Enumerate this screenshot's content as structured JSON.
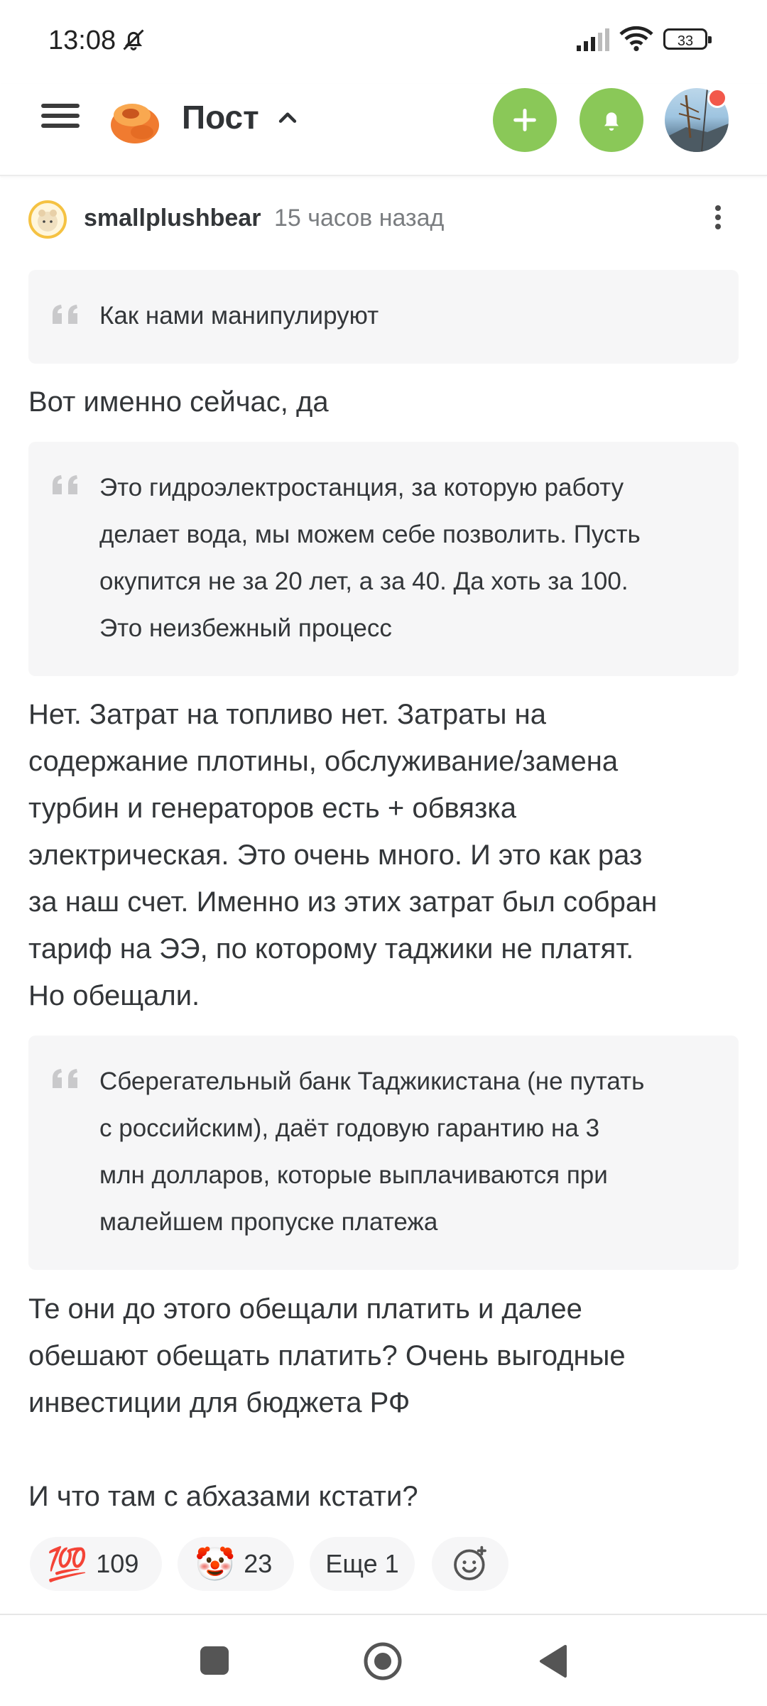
{
  "status_bar": {
    "time": "13:08",
    "battery": "33"
  },
  "header": {
    "title": "Пост"
  },
  "comment": {
    "author": "smallplushbear",
    "time": "15 часов назад",
    "quote1": "Как нами манипулируют",
    "text1": "Вот именно сейчас, да",
    "quote2_lines": [
      "Это гидроэлектростанция, за которую работу",
      "делает вода, мы можем себе позволить. Пусть",
      "окупится не за 20 лет, а за 40. Да хоть за 100.",
      "Это неизбежный процесс"
    ],
    "text2_lines": [
      "Нет. Затрат на топливо нет. Затраты на",
      "содержание плотины, обслуживание/замена",
      "турбин и генераторов есть + обвязка",
      "электрическая. Это очень много. И это как раз",
      "за наш счет. Именно из этих затрат был собран",
      "тариф на ЭЭ, по которому таджики не платят.",
      "Но обещали."
    ],
    "quote3_lines": [
      "Сберегательный банк Таджикистана (не путать",
      "с российским), даёт годовую гарантию на 3",
      "млн долларов, которые выплачиваются при",
      "малейшем пропуске платежа"
    ],
    "text3_lines": [
      "Те они до этого обещали платить и далее",
      "обешают обещать платить? Очень выгодные",
      "инвестиции для бюджета РФ"
    ],
    "text4": "И что там с абхазами кстати?"
  },
  "reactions": [
    {
      "emoji": "💯",
      "count": "109"
    },
    {
      "emoji": "🤡",
      "count": "23"
    },
    {
      "label": "Еще 1"
    }
  ],
  "colors": {
    "accent_green": "#8ac858",
    "notification_red": "#f2584b",
    "quote_bg": "#f6f6f7"
  }
}
